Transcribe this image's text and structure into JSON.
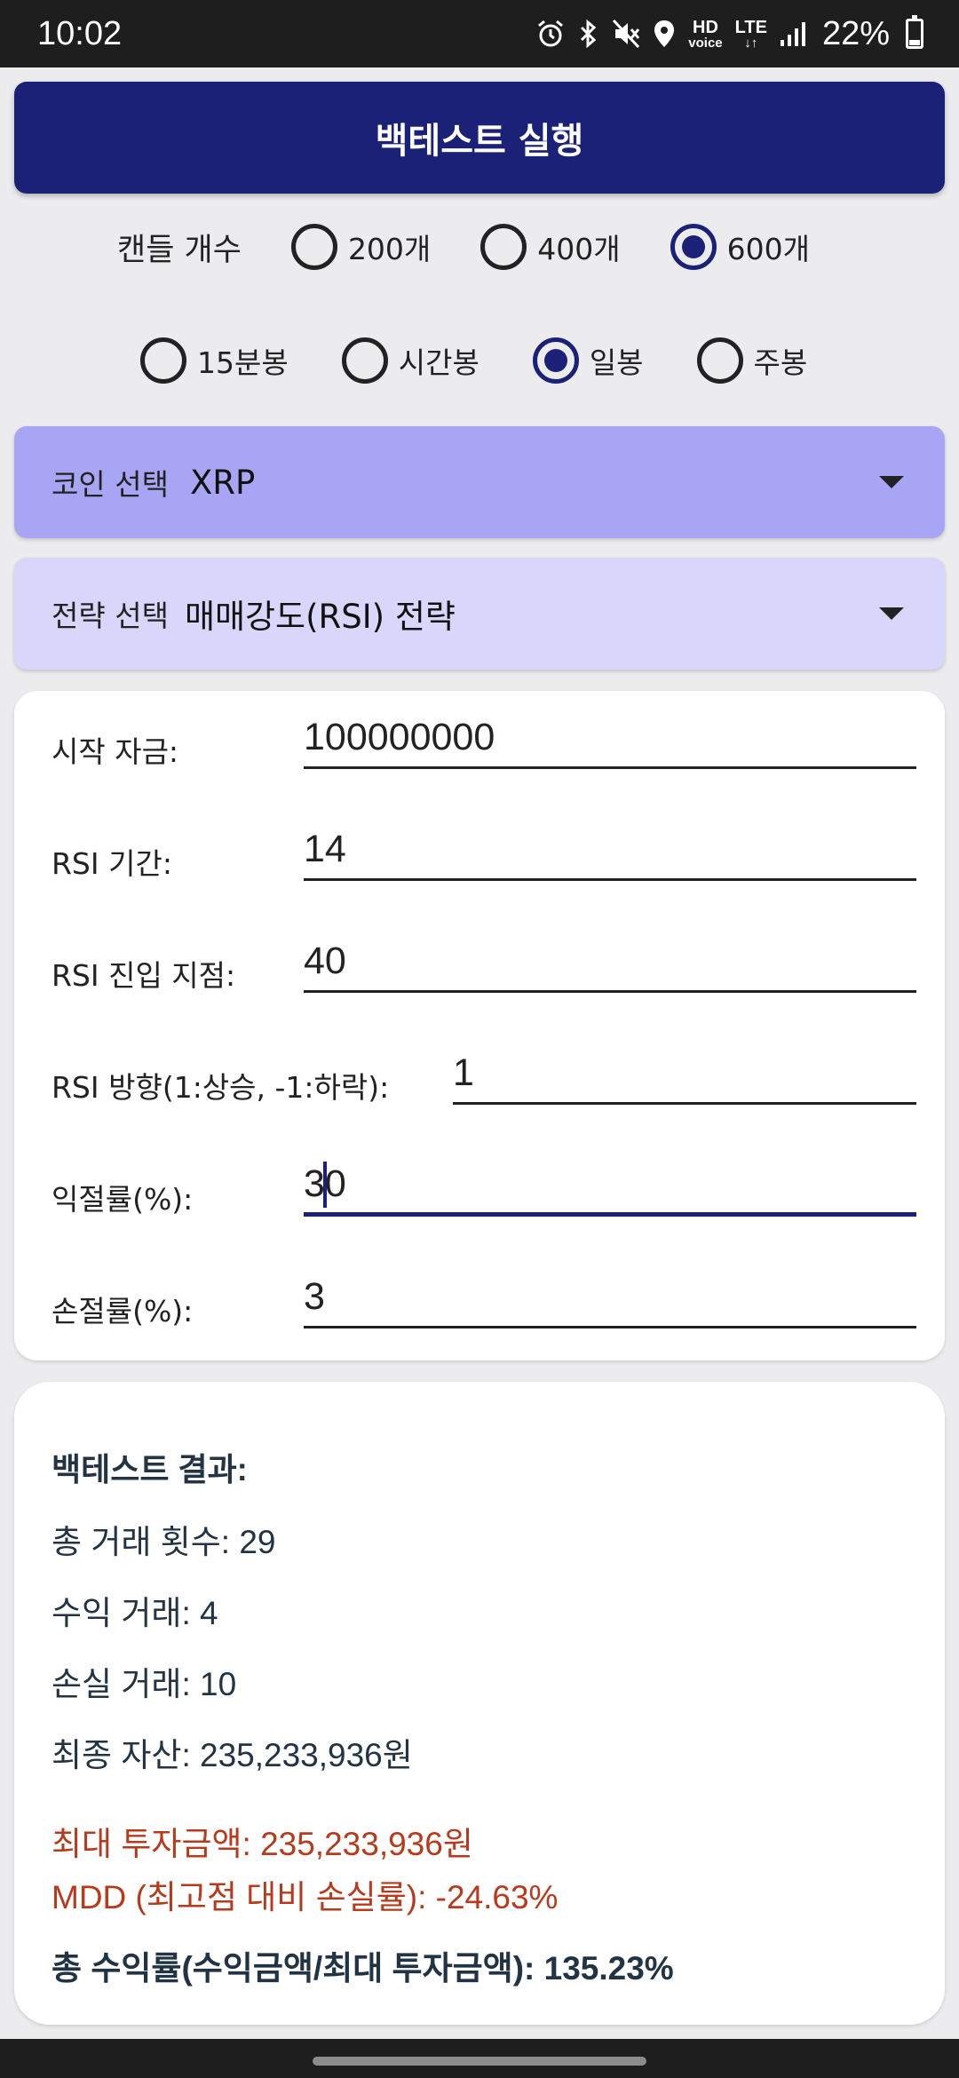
{
  "status_bar": {
    "time": "10:02",
    "icons": [
      "alarm-icon",
      "bluetooth-icon",
      "mute-icon",
      "location-icon",
      "hd-voice-icon",
      "lte-icon",
      "signal-icon"
    ],
    "hd_top": "HD",
    "hd_bottom": "voice",
    "lte_top": "LTE",
    "lte_bottom": "↓↑",
    "battery": "22%"
  },
  "run_button": {
    "label": "백테스트 실행"
  },
  "candle_count": {
    "label": "캔들 개수",
    "options": [
      "200개",
      "400개",
      "600개"
    ],
    "selected": "600개"
  },
  "interval": {
    "options": [
      "15분봉",
      "시간봉",
      "일봉",
      "주봉"
    ],
    "selected": "일봉"
  },
  "coin": {
    "label": "코인 선택",
    "value": "XRP"
  },
  "strategy": {
    "label": "전략 선택",
    "value": "매매강도(RSI) 전략"
  },
  "params": {
    "start_capital": {
      "label": "시작 자금:",
      "value": "100000000"
    },
    "rsi_period": {
      "label": "RSI 기간:",
      "value": "14"
    },
    "rsi_entry": {
      "label": "RSI 진입 지점:",
      "value": "40"
    },
    "rsi_direction": {
      "label": "RSI 방향(1:상승, -1:하락):",
      "value": "1"
    },
    "take_profit": {
      "label": "익절률(%):",
      "value": "30"
    },
    "stop_loss": {
      "label": "손절률(%):",
      "value": "3"
    }
  },
  "results": {
    "title": "백테스트 결과:",
    "total_trades": "총 거래 횟수: 29",
    "win_trades": "수익 거래: 4",
    "loss_trades": "손실 거래: 10",
    "final_asset": "최종 자산: 235,233,936원",
    "max_investment": "최대 투자금액: 235,233,936원",
    "mdd": "MDD (최고점 대비 손실률): -24.63%",
    "total_return": "총 수익률(수익금액/최대 투자금액): 135.23%"
  },
  "colors": {
    "primary": "#1c2178",
    "coin_dropdown_bg": "#a9a5f5",
    "strategy_dropdown_bg": "#d9d6fb",
    "warning_text": "#b83a1d"
  }
}
